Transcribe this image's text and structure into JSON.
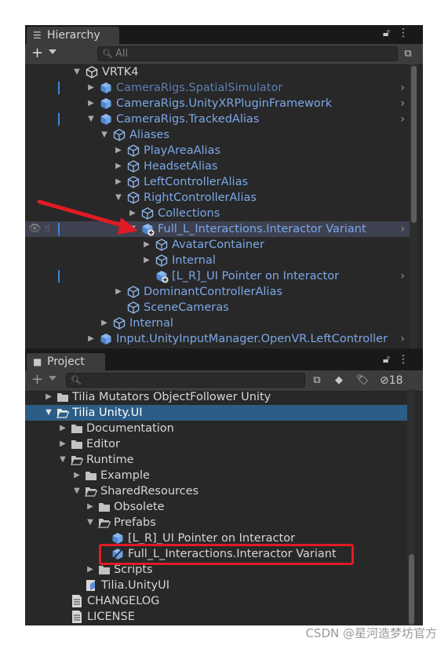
{
  "hierarchy": {
    "tab_label": "Hierarchy",
    "search_placeholder": "All",
    "items": [
      {
        "label": "VRTK4"
      },
      {
        "label": "CameraRigs.SpatialSimulator"
      },
      {
        "label": "CameraRigs.UnityXRPluginFramework"
      },
      {
        "label": "CameraRigs.TrackedAlias"
      },
      {
        "label": "Aliases"
      },
      {
        "label": "PlayAreaAlias"
      },
      {
        "label": "HeadsetAlias"
      },
      {
        "label": "LeftControllerAlias"
      },
      {
        "label": "RightControllerAlias"
      },
      {
        "label": "Collections"
      },
      {
        "label": "Full_L_Interactions.Interactor Variant"
      },
      {
        "label": "AvatarContainer"
      },
      {
        "label": "Internal"
      },
      {
        "label": "[L_R]_UI Pointer on Interactor"
      },
      {
        "label": "DominantControllerAlias"
      },
      {
        "label": "SceneCameras"
      },
      {
        "label": "Internal"
      },
      {
        "label": "Input.UnityInputManager.OpenVR.LeftController"
      }
    ]
  },
  "project": {
    "tab_label": "Project",
    "hidden_count": "18",
    "items": [
      {
        "label": "Tilia Mutators ObjectFollower Unity"
      },
      {
        "label": "Tilia Unity.UI"
      },
      {
        "label": "Documentation"
      },
      {
        "label": "Editor"
      },
      {
        "label": "Runtime"
      },
      {
        "label": "Example"
      },
      {
        "label": "SharedResources"
      },
      {
        "label": "Obsolete"
      },
      {
        "label": "Prefabs"
      },
      {
        "label": "[L_R]_UI Pointer on Interactor"
      },
      {
        "label": "Full_L_Interactions.Interactor Variant"
      },
      {
        "label": "Scripts"
      },
      {
        "label": "Tilia.UnityUI"
      },
      {
        "label": "CHANGELOG"
      },
      {
        "label": "LICENSE"
      }
    ]
  },
  "watermark": "CSDN @星河造梦坊官方",
  "colors": {
    "annotation_red": "#e01b24",
    "prefab_blue": "#7ba8e8",
    "selection_blue": "#2c5d87"
  }
}
